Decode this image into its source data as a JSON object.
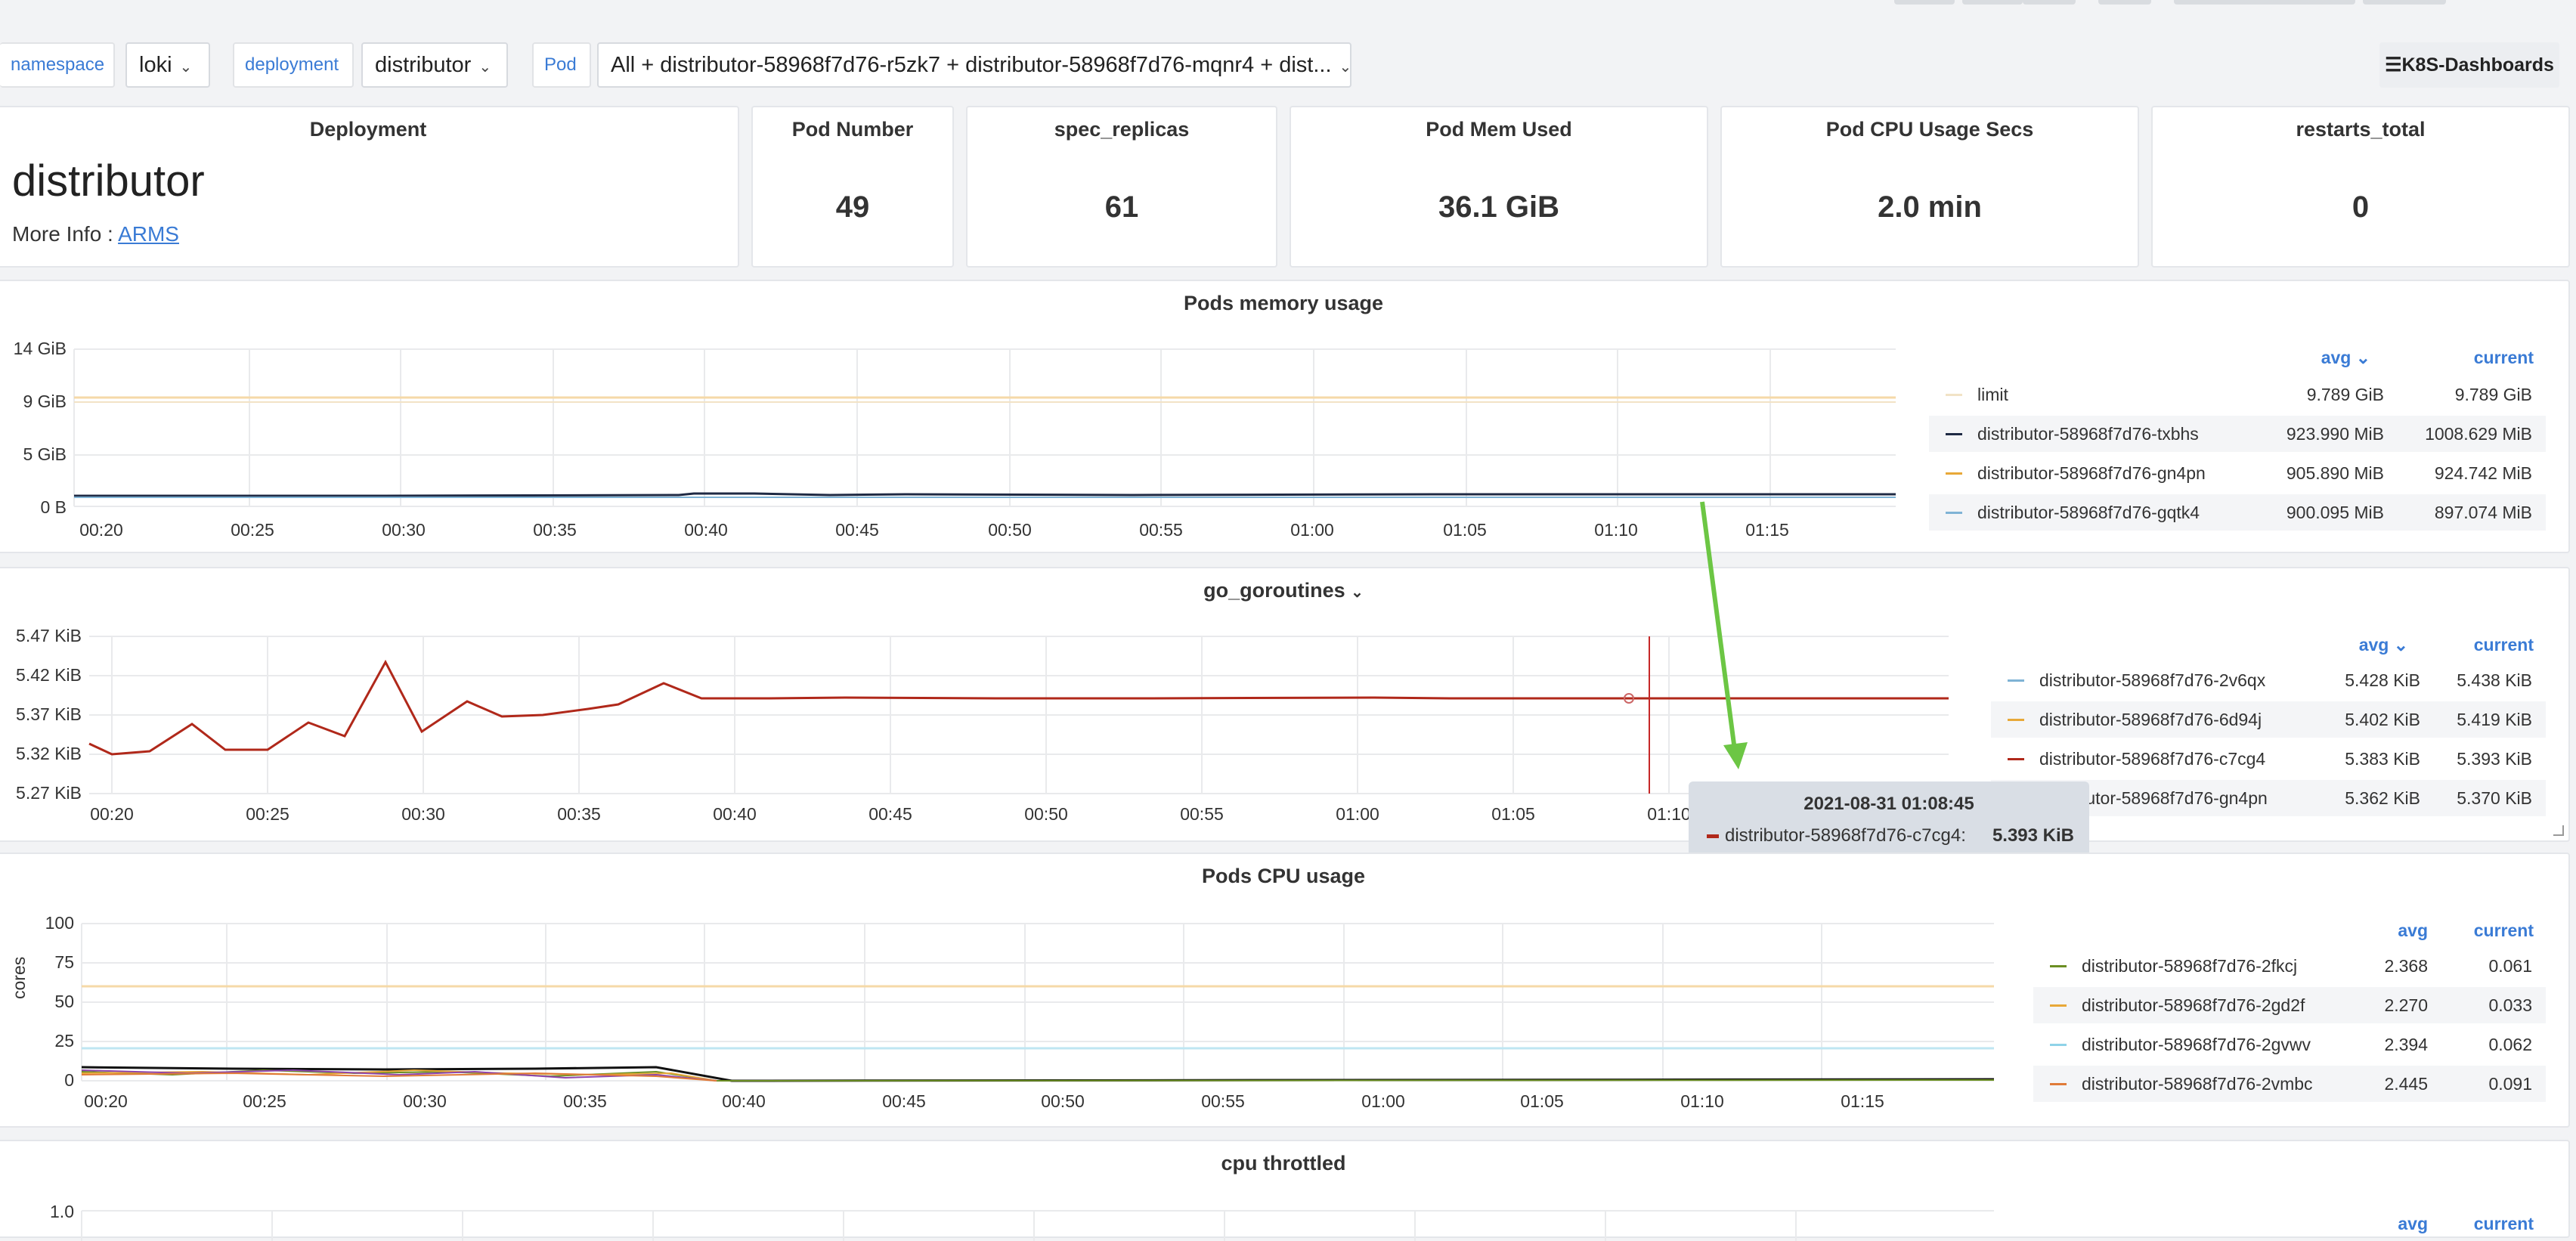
{
  "variables": {
    "namespace_label": "namespace",
    "namespace_value": "loki",
    "deployment_label": "deployment",
    "deployment_value": "distributor",
    "pod_label": "Pod",
    "pod_value": "All + distributor-58968f7d76-r5zk7 + distributor-58968f7d76-mqnr4 + dist..."
  },
  "dashboards_link": "K8S-Dashboards",
  "deployment_panel": {
    "title": "Deployment",
    "name": "distributor",
    "more_info_label": "More Info :",
    "link": "ARMS"
  },
  "stats": [
    {
      "title": "Pod Number",
      "value": "49"
    },
    {
      "title": "spec_replicas",
      "value": "61"
    },
    {
      "title": "Pod Mem Used",
      "value": "36.1 GiB"
    },
    {
      "title": "Pod CPU Usage Secs",
      "value": "2.0 min"
    },
    {
      "title": "restarts_total",
      "value": "0"
    }
  ],
  "memory_panel": {
    "title": "Pods memory usage",
    "yticks": [
      "14 GiB",
      "9 GiB",
      "5 GiB",
      "0 B"
    ],
    "xticks": [
      "00:20",
      "00:25",
      "00:30",
      "00:35",
      "00:40",
      "00:45",
      "00:50",
      "00:55",
      "01:00",
      "01:05",
      "01:10",
      "01:15"
    ],
    "legend_avg": "avg",
    "legend_current": "current",
    "legend": [
      {
        "name": "limit",
        "avg": "9.789 GiB",
        "current": "9.789 GiB",
        "color": "#f2e3c6"
      },
      {
        "name": "distributor-58968f7d76-txbhs",
        "avg": "923.990 MiB",
        "current": "1008.629 MiB",
        "color": "#1f2a44"
      },
      {
        "name": "distributor-58968f7d76-gn4pn",
        "avg": "905.890 MiB",
        "current": "924.742 MiB",
        "color": "#e8a838"
      },
      {
        "name": "distributor-58968f7d76-gqtk4",
        "avg": "900.095 MiB",
        "current": "897.074 MiB",
        "color": "#7fb3d5"
      }
    ]
  },
  "goroutines_panel": {
    "title": "go_goroutines",
    "yticks": [
      "5.47 KiB",
      "5.42 KiB",
      "5.37 KiB",
      "5.32 KiB",
      "5.27 KiB"
    ],
    "xticks": [
      "00:20",
      "00:25",
      "00:30",
      "00:35",
      "00:40",
      "00:45",
      "00:50",
      "00:55",
      "01:00",
      "01:05",
      "01:10"
    ],
    "legend_avg": "avg",
    "legend_current": "current",
    "legend": [
      {
        "name": "distributor-58968f7d76-2v6qx",
        "avg": "5.428 KiB",
        "current": "5.438 KiB",
        "color": "#7fb3d5"
      },
      {
        "name": "distributor-58968f7d76-6d94j",
        "avg": "5.402 KiB",
        "current": "5.419 KiB",
        "color": "#e8a838"
      },
      {
        "name": "distributor-58968f7d76-c7cg4",
        "avg": "5.383 KiB",
        "current": "5.393 KiB",
        "color": "#b0281a"
      },
      {
        "name": "distributor-58968f7d76-gn4pn",
        "avg": "5.362 KiB",
        "current": "5.370 KiB",
        "color": "#1f2a44"
      }
    ],
    "tooltip": {
      "time": "2021-08-31 01:08:45",
      "series": "distributor-58968f7d76-c7cg4:",
      "value": "5.393 KiB"
    }
  },
  "cpu_panel": {
    "title": "Pods CPU usage",
    "ylabel": "cores",
    "yticks": [
      "100",
      "75",
      "50",
      "25",
      "0"
    ],
    "xticks": [
      "00:20",
      "00:25",
      "00:30",
      "00:35",
      "00:40",
      "00:45",
      "00:50",
      "00:55",
      "01:00",
      "01:05",
      "01:10",
      "01:15"
    ],
    "legend_avg": "avg",
    "legend_current": "current",
    "legend": [
      {
        "name": "distributor-58968f7d76-2fkcj",
        "avg": "2.368",
        "current": "0.061",
        "color": "#6b8e23"
      },
      {
        "name": "distributor-58968f7d76-2gd2f",
        "avg": "2.270",
        "current": "0.033",
        "color": "#e8a838"
      },
      {
        "name": "distributor-58968f7d76-2gvwv",
        "avg": "2.394",
        "current": "0.062",
        "color": "#8fd3e8"
      },
      {
        "name": "distributor-58968f7d76-2vmbc",
        "avg": "2.445",
        "current": "0.091",
        "color": "#e07b39"
      }
    ]
  },
  "throttled_panel": {
    "title": "cpu throttled",
    "ytick_top": "1.0",
    "legend_avg": "avg",
    "legend_current": "current"
  }
}
